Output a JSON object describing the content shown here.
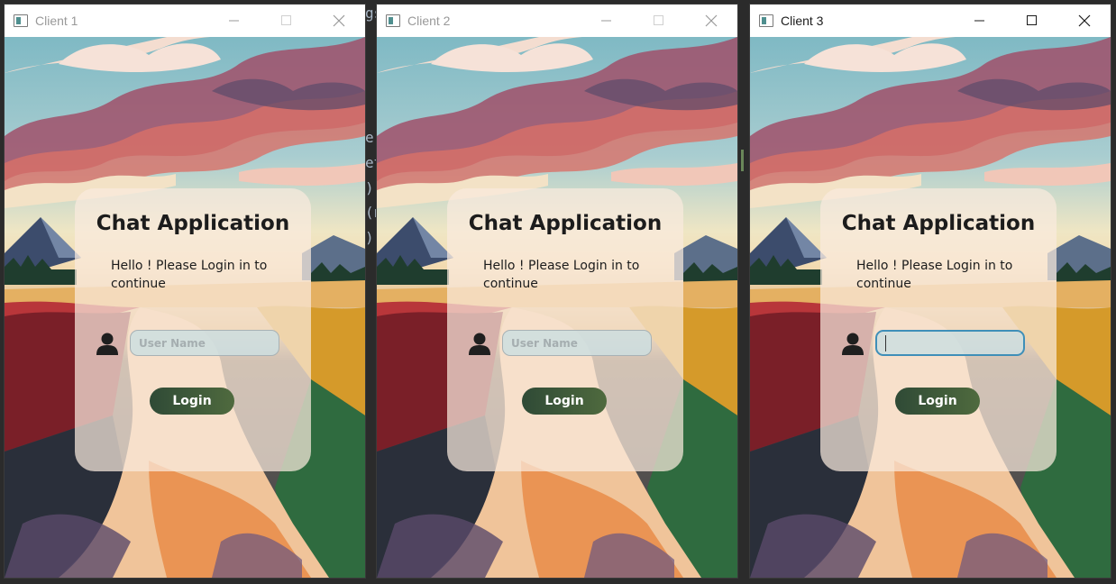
{
  "clients": [
    {
      "window_title": "Client 1",
      "active": false,
      "heading": "Chat Application",
      "subtitle": "Hello ! Please Login in to continue",
      "username_placeholder": "User Name",
      "username_value": "",
      "focused": false,
      "login_label": "Login"
    },
    {
      "window_title": "Client 2",
      "active": false,
      "heading": "Chat Application",
      "subtitle": "Hello ! Please Login in to continue",
      "username_placeholder": "User Name",
      "username_value": "",
      "focused": false,
      "login_label": "Login"
    },
    {
      "window_title": "Client 3",
      "active": true,
      "heading": "Chat Application",
      "subtitle": "Hello ! Please Login in to continue",
      "username_placeholder": "",
      "username_value": "",
      "focused": true,
      "login_label": "Login"
    }
  ],
  "icons": {
    "app": "app-window-icon",
    "minimize": "minimize-icon",
    "maximize": "maximize-icon",
    "close": "close-icon",
    "user": "user-icon"
  },
  "colors": {
    "login_button_start": "#2f4a36",
    "login_button_end": "#4f6a3e",
    "focus_border": "#3f8fb8"
  }
}
